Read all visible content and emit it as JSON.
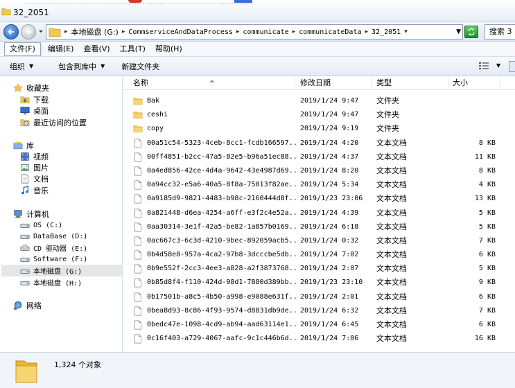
{
  "window": {
    "title": "32_2051"
  },
  "address": {
    "segments": [
      "本地磁盘 (G:)",
      "CommserviceAndDataProcess",
      "communicate",
      "communicateData",
      "32_2051"
    ],
    "search_label": "搜索 3"
  },
  "menu": [
    "文件(F)",
    "编辑(E)",
    "查看(V)",
    "工具(T)",
    "帮助(H)"
  ],
  "commands": {
    "organize": "组织",
    "include": "包含到库中",
    "new_folder": "新建文件夹"
  },
  "nav": {
    "favorites": {
      "label": "收藏夹",
      "items": [
        "下载",
        "桌面",
        "最近访问的位置"
      ]
    },
    "libraries": {
      "label": "库",
      "items": [
        "视频",
        "图片",
        "文档",
        "音乐"
      ]
    },
    "computer": {
      "label": "计算机",
      "drives": [
        "OS (C:)",
        "DataBase (D:)",
        "CD 驱动器 (E:)",
        "Software (F:)",
        "本地磁盘 (G:)",
        "本地磁盘 (H:)"
      ],
      "selected": "本地磁盘 (G:)"
    },
    "network": {
      "label": "网络"
    }
  },
  "columns": {
    "name": "名称",
    "modified": "修改日期",
    "type": "类型",
    "size": "大小"
  },
  "files": [
    {
      "name": "Bak",
      "date": "2019/1/24 9:47",
      "type": "文件夹",
      "size": "",
      "kind": "folder"
    },
    {
      "name": "ceshi",
      "date": "2019/1/24 9:47",
      "type": "文件夹",
      "size": "",
      "kind": "folder"
    },
    {
      "name": "copy",
      "date": "2019/1/24 9:19",
      "type": "文件夹",
      "size": "",
      "kind": "folder"
    },
    {
      "name": "00a51c54-5323-4ceb-8cc1-fcdb166597...",
      "date": "2019/1/24 4:20",
      "type": "文本文档",
      "size": "8 KB",
      "kind": "file"
    },
    {
      "name": "00ff4851-b2cc-47a5-82e5-b96a51ec88...",
      "date": "2019/1/24 4:37",
      "type": "文本文档",
      "size": "11 KB",
      "kind": "file"
    },
    {
      "name": "0a4ed856-42ce-4d4a-9642-43e4987d69...",
      "date": "2019/1/24 8:20",
      "type": "文本文档",
      "size": "8 KB",
      "kind": "file"
    },
    {
      "name": "0a94cc32-e5a6-40a5-8f8a-75013f82ae...",
      "date": "2019/1/24 5:34",
      "type": "文本文档",
      "size": "4 KB",
      "kind": "file"
    },
    {
      "name": "0a9185d9-9821-4483-b98c-2160444d8f...",
      "date": "2019/1/23 23:06",
      "type": "文本文档",
      "size": "13 KB",
      "kind": "file"
    },
    {
      "name": "0a821448-d6ea-4254-a6ff-e3f2c4e52a...",
      "date": "2019/1/24 4:39",
      "type": "文本文档",
      "size": "5 KB",
      "kind": "file"
    },
    {
      "name": "0aa30314-3e1f-42a5-be82-1a857b0169...",
      "date": "2019/1/24 6:18",
      "type": "文本文档",
      "size": "5 KB",
      "kind": "file"
    },
    {
      "name": "0ac667c3-6c3d-4210-9bec-892059acb5...",
      "date": "2019/1/24 0:32",
      "type": "文本文档",
      "size": "7 KB",
      "kind": "file"
    },
    {
      "name": "0b4d58e8-957a-4ca2-97b8-3dcccbe5db...",
      "date": "2019/1/24 7:02",
      "type": "文本文档",
      "size": "6 KB",
      "kind": "file"
    },
    {
      "name": "0b9e552f-2cc3-4ee3-a828-a2f3873768...",
      "date": "2019/1/24 2:07",
      "type": "文本文档",
      "size": "5 KB",
      "kind": "file"
    },
    {
      "name": "0b85d8f4-f110-424d-98d1-7880d389bb...",
      "date": "2019/1/23 23:10",
      "type": "文本文档",
      "size": "9 KB",
      "kind": "file"
    },
    {
      "name": "0b17501b-a8c5-4b50-a998-e9088e631f...",
      "date": "2019/1/24 2:01",
      "type": "文本文档",
      "size": "6 KB",
      "kind": "file"
    },
    {
      "name": "0bea8d93-8c86-4f93-9574-d8831db9de...",
      "date": "2019/1/24 6:32",
      "type": "文本文档",
      "size": "7 KB",
      "kind": "file"
    },
    {
      "name": "0bedc47e-1098-4cd9-ab94-aad63114e1...",
      "date": "2019/1/24 6:45",
      "type": "文本文档",
      "size": "6 KB",
      "kind": "file"
    },
    {
      "name": "0c16f403-a729-4067-aafc-9c1c446b6d...",
      "date": "2019/1/24 7:06",
      "type": "文本文档",
      "size": "16 KB",
      "kind": "file"
    }
  ],
  "status": {
    "count": "1,324 个对象"
  },
  "colors": {
    "folder": "#f2c94c",
    "accent": "#1c5fb8",
    "selection": "#e6e6e6"
  }
}
